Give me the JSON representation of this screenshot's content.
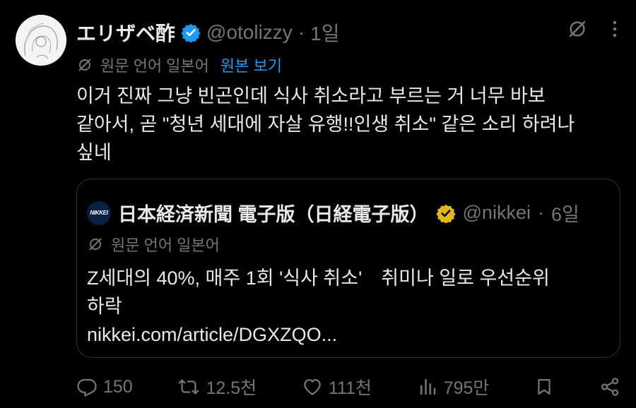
{
  "tweet": {
    "display_name": "エリザベ酢",
    "handle": "@otolizzy",
    "separator": "·",
    "time": "1일",
    "translation": {
      "language_note": "원문 언어 일본어",
      "show_original": "원본 보기"
    },
    "text": "이거 진짜 그냥 빈곤인데 식사 취소라고 부르는 거 너무 바보\n같아서, 곧 \"청년 세대에 자살 유행!!인생 취소\" 같은 소리 하려나\n싶네"
  },
  "quote": {
    "avatar_text": "NIKKEI",
    "display_name": "日本経済新聞 電子版（日経電子版）",
    "handle": "@nikkei",
    "separator": "·",
    "time": "6일",
    "translation": {
      "language_note": "원문 언어 일본어"
    },
    "text": "Z세대의 40%, 매주 1회 '식사 취소'　취미나 일로 우선순위\n하락\nnikkei.com/article/DGXZQO..."
  },
  "actions": {
    "replies": "150",
    "reposts": "12.5천",
    "likes": "111천",
    "views": "795만"
  },
  "colors": {
    "background": "#000000",
    "text": "#e7e9ea",
    "muted": "#71767b",
    "link": "#1d9bf0",
    "verified_blue": "#1d9bf0",
    "verified_gold": "#e2b719"
  },
  "icons": [
    "translate-off-icon",
    "more-icon",
    "verified-badge-icon",
    "reply-icon",
    "repost-icon",
    "like-icon",
    "views-icon",
    "bookmark-icon",
    "share-icon"
  ]
}
